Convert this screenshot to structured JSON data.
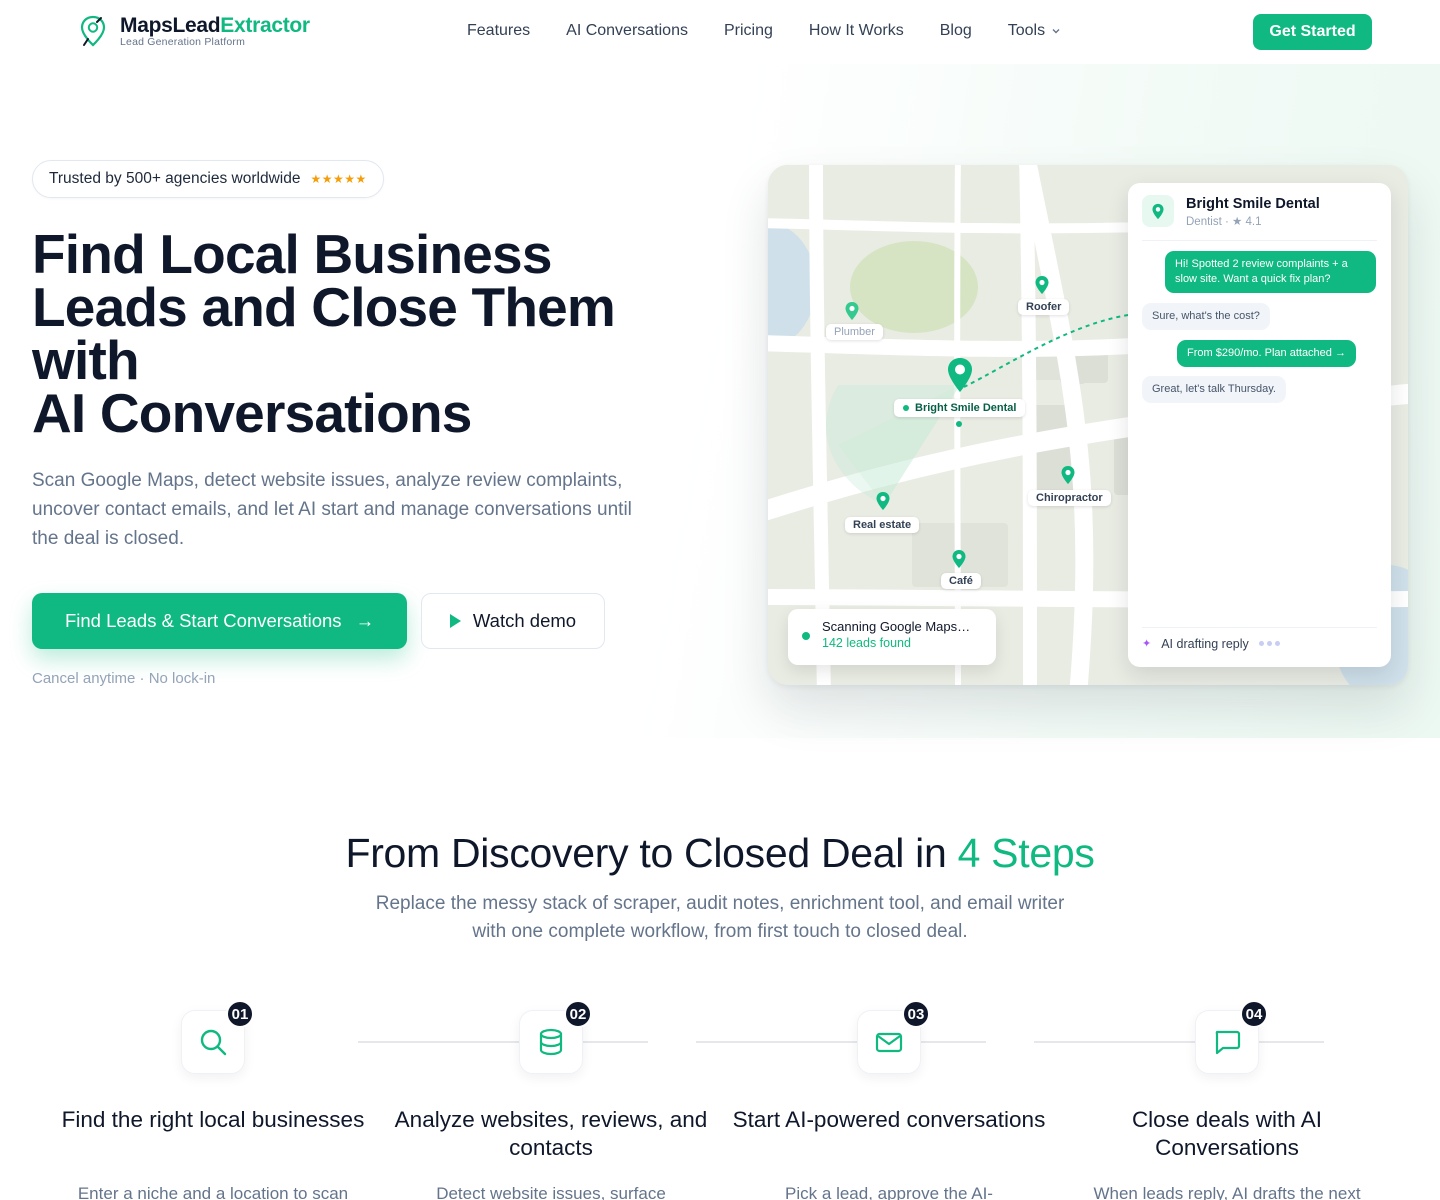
{
  "header": {
    "logo_name_main": "MapsLead",
    "logo_name_accent": "Extractor",
    "logo_sub": "Lead Generation Platform",
    "nav": [
      {
        "label": "Features"
      },
      {
        "label": "AI Conversations"
      },
      {
        "label": "Pricing"
      },
      {
        "label": "How It Works"
      },
      {
        "label": "Blog"
      },
      {
        "label": "Tools"
      }
    ],
    "cta": "Get Started"
  },
  "hero": {
    "badge": "Trusted by 500+ agencies worldwide",
    "stars": "★★★★★",
    "rating_stars": 5,
    "title_lines": [
      "Find Local Business",
      "Leads and Close Them",
      "with"
    ],
    "title_highlight": "AI Conversations",
    "subtitle": "Scan Google Maps, detect website issues, analyze review complaints, uncover contact emails, and let AI start and manage conversations until the deal is closed.",
    "primary_cta": "Find Leads & Start Conversations",
    "primary_arrow": "→",
    "secondary_cta": "Watch demo",
    "note": "Cancel anytime · No lock-in"
  },
  "map": {
    "pins": {
      "plumber": "Plumber",
      "roofer": "Roofer",
      "main": "Bright Smile Dental",
      "chiropractor": "Chiropractor",
      "real_estate": "Real estate",
      "cafe": "Café"
    },
    "scan": {
      "title": "Scanning Google Maps…",
      "count": "142 leads found"
    },
    "chat": {
      "name": "Bright Smile Dental",
      "meta": "Dentist · ★ 4.1",
      "messages": [
        {
          "text": "Hi! Spotted 2 review complaints + a slow site. Want a quick fix plan?"
        },
        {
          "text": "Sure, what's the cost?"
        },
        {
          "text": "From $290/mo. Plan attached →"
        },
        {
          "text": "Great, let's talk Thursday."
        }
      ],
      "footer_icon": "✦",
      "footer": "AI drafting reply"
    }
  },
  "steps": {
    "title_main": "From Discovery to Closed Deal in ",
    "title_accent": "4 Steps",
    "subtitle": "Replace the messy stack of scraper, audit notes, enrichment tool, and email writer with one complete workflow, from first touch to closed deal.",
    "items": [
      {
        "num": "01",
        "icon": "search-icon",
        "title": "Find the right local businesses",
        "desc": "Enter a niche and a location to scan"
      },
      {
        "num": "02",
        "icon": "database-icon",
        "title": "Analyze websites, reviews, and contacts",
        "desc": "Detect website issues, surface"
      },
      {
        "num": "03",
        "icon": "mail-icon",
        "title": "Start AI-powered conversations",
        "desc": "Pick a lead, approve the AI-"
      },
      {
        "num": "04",
        "icon": "chat-icon",
        "title": "Close deals with AI Conversations",
        "desc": "When leads reply, AI drafts the next"
      }
    ]
  },
  "colors": {
    "accent": "#10b981",
    "text": "#0f172a",
    "muted": "#64748b"
  }
}
